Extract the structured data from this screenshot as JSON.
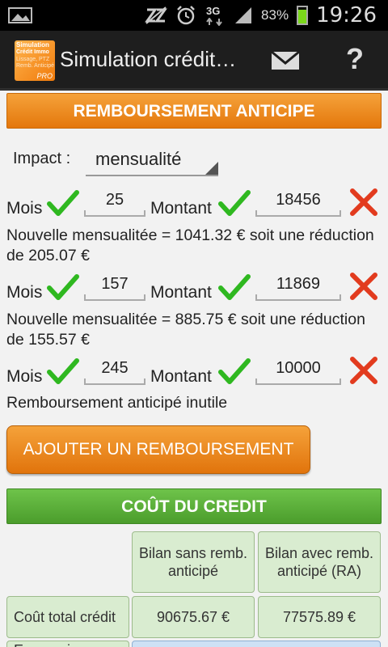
{
  "status_bar": {
    "battery_percent": "83%",
    "time": "19:26",
    "network": "3G",
    "battery_level": 0.83,
    "icons": [
      "image-icon",
      "mute-icon",
      "alarm-icon",
      "3g-icon",
      "signal-icon",
      "battery-icon"
    ]
  },
  "action_bar": {
    "title": "Simulation crédit…",
    "app_icon_lines": [
      "Simulation",
      "Crédit Immo",
      "Lissage, PTZ",
      "Remb. Anticipé"
    ],
    "app_icon_badge": "PRO",
    "mail_icon": "mail-icon",
    "help_label": "?"
  },
  "remboursement": {
    "header": "REMBOURSEMENT ANTICIPE",
    "impact_label": "Impact :",
    "impact_value": "mensualité",
    "mois_label": "Mois",
    "montant_label": "Montant",
    "entries": [
      {
        "mois": "25",
        "montant": "18456",
        "note": "Nouvelle mensualitée = 1041.32 € soit une réduction de 205.07 €"
      },
      {
        "mois": "157",
        "montant": "11869",
        "note": "Nouvelle mensualitée = 885.75 € soit une réduction de 155.57 €"
      },
      {
        "mois": "245",
        "montant": "10000",
        "note": "Remboursement anticipé inutile"
      }
    ],
    "add_button": "AJOUTER UN REMBOURSEMENT"
  },
  "cout": {
    "header": "COÛT DU CREDIT",
    "col1": "Bilan sans remb. anticipé",
    "col2": "Bilan avec remb. anticipé (RA)",
    "rows": [
      {
        "label": "Coût total crédit",
        "v1": "90675.67 €",
        "v2": "77575.89 €"
      },
      {
        "label": "Economie",
        "v1": "",
        "v2": ""
      }
    ]
  },
  "colors": {
    "orange": "#e4770c",
    "green": "#4b9d2c",
    "check_green": "#2fb820",
    "delete_red": "#e23b1e"
  }
}
